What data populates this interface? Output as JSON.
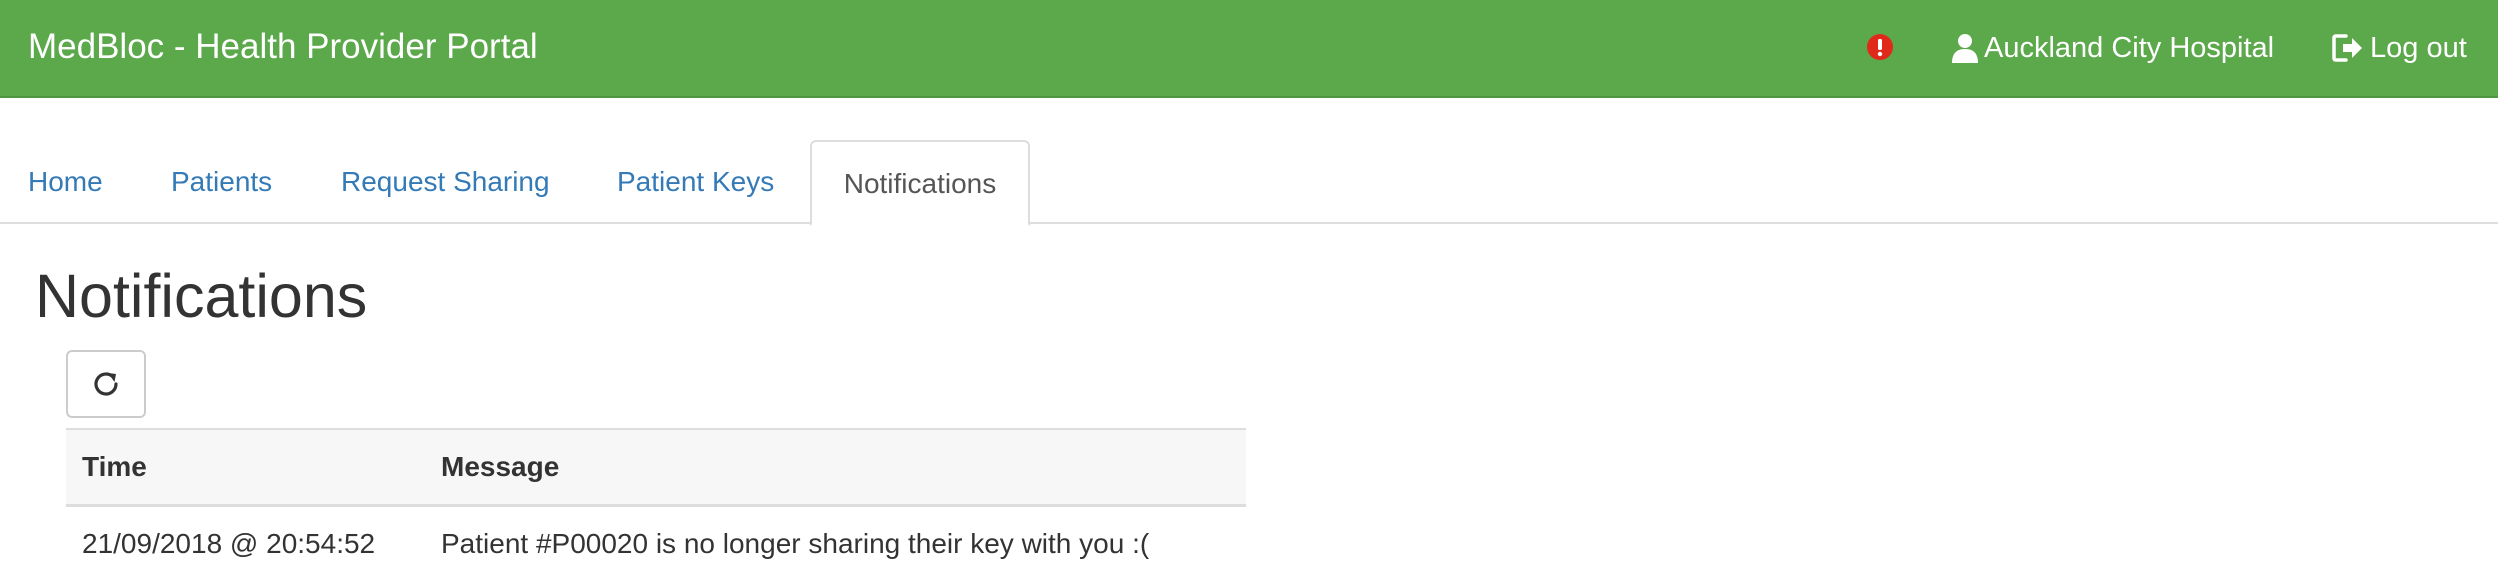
{
  "header": {
    "brand": "MedBloc - Health Provider Portal",
    "alert_icon": "exclamation-circle-icon",
    "alert_color": "#e0291b",
    "user_label": "Auckland City Hospital",
    "user_icon": "user-icon",
    "logout_label": "Log out",
    "logout_icon": "logout-icon",
    "bar_color": "#5ca94c"
  },
  "tabs": [
    {
      "label": "Home",
      "active": false
    },
    {
      "label": "Patients",
      "active": false
    },
    {
      "label": "Request Sharing",
      "active": false
    },
    {
      "label": "Patient Keys",
      "active": false
    },
    {
      "label": "Notifications",
      "active": true
    }
  ],
  "main": {
    "title": "Notifications",
    "refresh_icon": "refresh-icon",
    "table": {
      "columns": [
        "Time",
        "Message"
      ],
      "rows": [
        {
          "time": "21/09/2018 @ 20:54:52",
          "message": "Patient #P00020 is no longer sharing their key with you :("
        }
      ]
    }
  }
}
